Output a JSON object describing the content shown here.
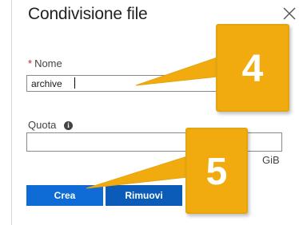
{
  "panel": {
    "title": "Condivisione file",
    "close_icon": "close-icon"
  },
  "form": {
    "name_field": {
      "required_marker": "*",
      "label": "Nome",
      "value": "archive"
    },
    "quota_field": {
      "label": "Quota",
      "info_icon": "info-icon",
      "info_glyph": "i",
      "value": "",
      "unit": "GiB"
    }
  },
  "buttons": {
    "create_label": "Crea",
    "remove_label": "Rimuovi"
  },
  "callouts": [
    {
      "number": "4"
    },
    {
      "number": "5"
    }
  ],
  "colors": {
    "primary_button": "#0f6cd6",
    "callout_fill": "#f2ab0e",
    "required_star": "#c4262e"
  }
}
